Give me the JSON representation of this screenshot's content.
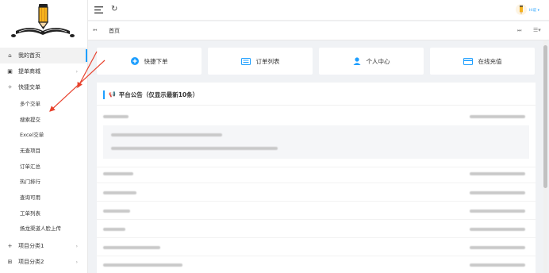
{
  "sidebar": {
    "items": [
      {
        "label": "我的首页",
        "icon": "home-icon",
        "glyph": "⌂",
        "chev": ""
      },
      {
        "label": "提单商城",
        "icon": "shop-icon",
        "glyph": "▣",
        "chev": "›"
      },
      {
        "label": "快捷交单",
        "icon": "wand-icon",
        "glyph": "✧",
        "chev": "›"
      }
    ],
    "subitems": [
      "多个交单",
      "搜索提交",
      "Excel交单",
      "无查项目",
      "订单汇总",
      "热门排行",
      "查询可用",
      "工单列表",
      "扬龙渠道人脸上传"
    ],
    "bottom_items": [
      {
        "label": "项目分类1",
        "glyph": "+",
        "chev": "›"
      },
      {
        "label": "项目分类2",
        "glyph": "⊞",
        "chev": "›"
      }
    ]
  },
  "topbar": {
    "refresh_glyph": "↻",
    "username": "Hi说 ▾"
  },
  "tabbar": {
    "prev": "⏮",
    "tab": "首页",
    "next": "⏭",
    "more": "☰▾"
  },
  "quick_buttons": [
    {
      "label": "快捷下单",
      "icon": "plus-circle-icon"
    },
    {
      "label": "订单列表",
      "icon": "list-icon"
    },
    {
      "label": "个人中心",
      "icon": "user-icon"
    },
    {
      "label": "在线充值",
      "icon": "credit-card-icon"
    }
  ],
  "announcement": {
    "title": "平台公告（仅显示最新10条）",
    "horn_glyph": "📢"
  },
  "colors": {
    "accent": "#1e9fff",
    "annotation": "#e8412c"
  }
}
